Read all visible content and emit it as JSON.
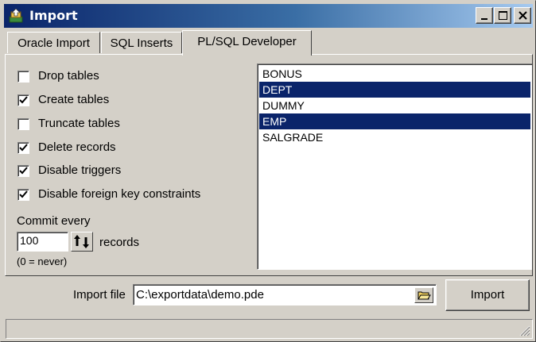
{
  "window": {
    "title": "Import",
    "icon": "import-app-icon",
    "controls": [
      "minimize-icon",
      "maximize-icon",
      "close-icon"
    ]
  },
  "tabs": [
    {
      "label": "Oracle Import",
      "active": false
    },
    {
      "label": "SQL Inserts",
      "active": false
    },
    {
      "label": "PL/SQL Developer",
      "active": true
    }
  ],
  "options": [
    {
      "label": "Drop tables",
      "checked": false
    },
    {
      "label": "Create tables",
      "checked": true
    },
    {
      "label": "Truncate tables",
      "checked": false
    },
    {
      "label": "Delete records",
      "checked": true
    },
    {
      "label": "Disable triggers",
      "checked": true
    },
    {
      "label": "Disable foreign key constraints",
      "checked": true
    }
  ],
  "commit": {
    "label": "Commit every",
    "value": "100",
    "suffix": "records",
    "note": "(0 = never)"
  },
  "tables": [
    {
      "name": "BONUS",
      "selected": false
    },
    {
      "name": "DEPT",
      "selected": true
    },
    {
      "name": "DUMMY",
      "selected": false
    },
    {
      "name": "EMP",
      "selected": true
    },
    {
      "name": "SALGRADE",
      "selected": false
    }
  ],
  "import_file": {
    "label": "Import file",
    "value": "C:\\exportdata\\demo.pde",
    "browse_icon": "folder-open-icon"
  },
  "import_button": "Import",
  "colors": {
    "titlebar_start": "#0a246a",
    "titlebar_end": "#a6caf0",
    "face": "#d4d0c8",
    "selection": "#0a246a"
  }
}
